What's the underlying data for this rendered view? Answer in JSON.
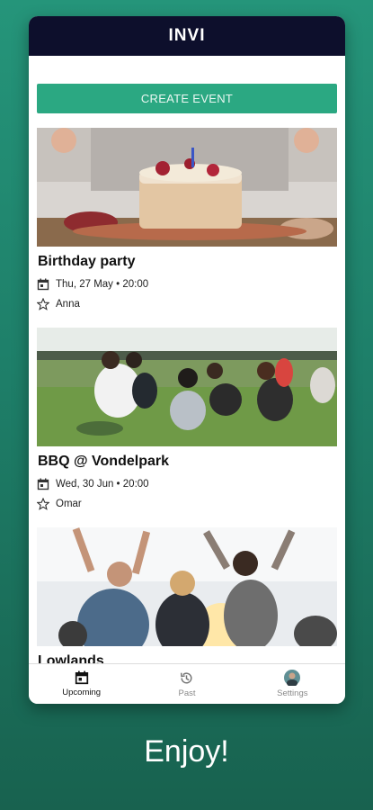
{
  "app": {
    "title": "INVI"
  },
  "create_button": "CREATE EVENT",
  "events": [
    {
      "title": "Birthday party",
      "datetime": "Thu, 27 May • 20:00",
      "host": "Anna"
    },
    {
      "title": "BBQ @ Vondelpark",
      "datetime": "Wed, 30 Jun • 20:00",
      "host": "Omar"
    },
    {
      "title": "Lowlands",
      "datetime": "",
      "host": ""
    }
  ],
  "nav": {
    "upcoming": "Upcoming",
    "past": "Past",
    "settings": "Settings"
  },
  "tagline": "Enjoy!",
  "colors": {
    "background": "#1e7f69",
    "appbar": "#0d0f2c",
    "button": "#2ba882"
  },
  "icons": [
    "calendar-icon",
    "star-icon",
    "history-icon",
    "avatar"
  ]
}
